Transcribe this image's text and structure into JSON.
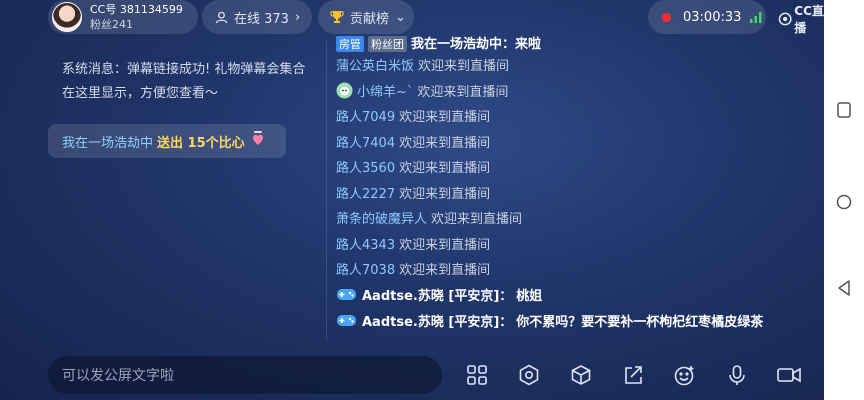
{
  "header": {
    "cc_id": "CC号 381134599",
    "fans": "粉丝241",
    "online_label": "在线 373",
    "contrib_label": "贡献榜",
    "timer": "03:00:33",
    "logo_text": "CC直播"
  },
  "left_panel": {
    "system_message": "系统消息：弹幕链接成功! 礼物弹幕会集合在这里显示，方便您查看～",
    "gift": {
      "user": "我在一场浩劫中",
      "action": "送出 15个比心"
    }
  },
  "chat": {
    "cut_row": {
      "tag": "房管",
      "badge": "粉丝团",
      "text": "我在一场浩劫中：来啦"
    },
    "messages": [
      {
        "name": "蒲公英白米饭",
        "text": "欢迎来到直播间",
        "avatar": false
      },
      {
        "name": "小绵羊~`",
        "text": "欢迎来到直播间",
        "avatar": true
      },
      {
        "name": "路人7049",
        "text": "欢迎来到直播间",
        "avatar": false
      },
      {
        "name": "路人7404",
        "text": "欢迎来到直播间",
        "avatar": false
      },
      {
        "name": "路人3560",
        "text": "欢迎来到直播间",
        "avatar": false
      },
      {
        "name": "路人2227",
        "text": "欢迎来到直播间",
        "avatar": false
      },
      {
        "name": "萧条的破魔异人",
        "text": "欢迎来到直播间",
        "avatar": false
      },
      {
        "name": "路人4343",
        "text": "欢迎来到直播间",
        "avatar": false
      },
      {
        "name": "路人7038",
        "text": "欢迎来到直播间",
        "avatar": false
      }
    ],
    "bold_messages": [
      {
        "name": "Aadtse.苏晓 [平安京]：",
        "text": "桃姐"
      },
      {
        "name": "Aadtse.苏晓 [平安京]：",
        "text": "你不累吗？要不要补一杯枸杞红枣橘皮绿茶"
      }
    ]
  },
  "bottom": {
    "input_placeholder": "可以发公屏文字啦",
    "tools": [
      "grid-icon",
      "settings-icon",
      "cube-icon",
      "share-icon",
      "emoji-icon",
      "mic-icon",
      "camera-icon"
    ]
  },
  "colors": {
    "username": "#8fc8ff",
    "gift_action": "#ffd766",
    "record_dot": "#ff2a2a"
  }
}
